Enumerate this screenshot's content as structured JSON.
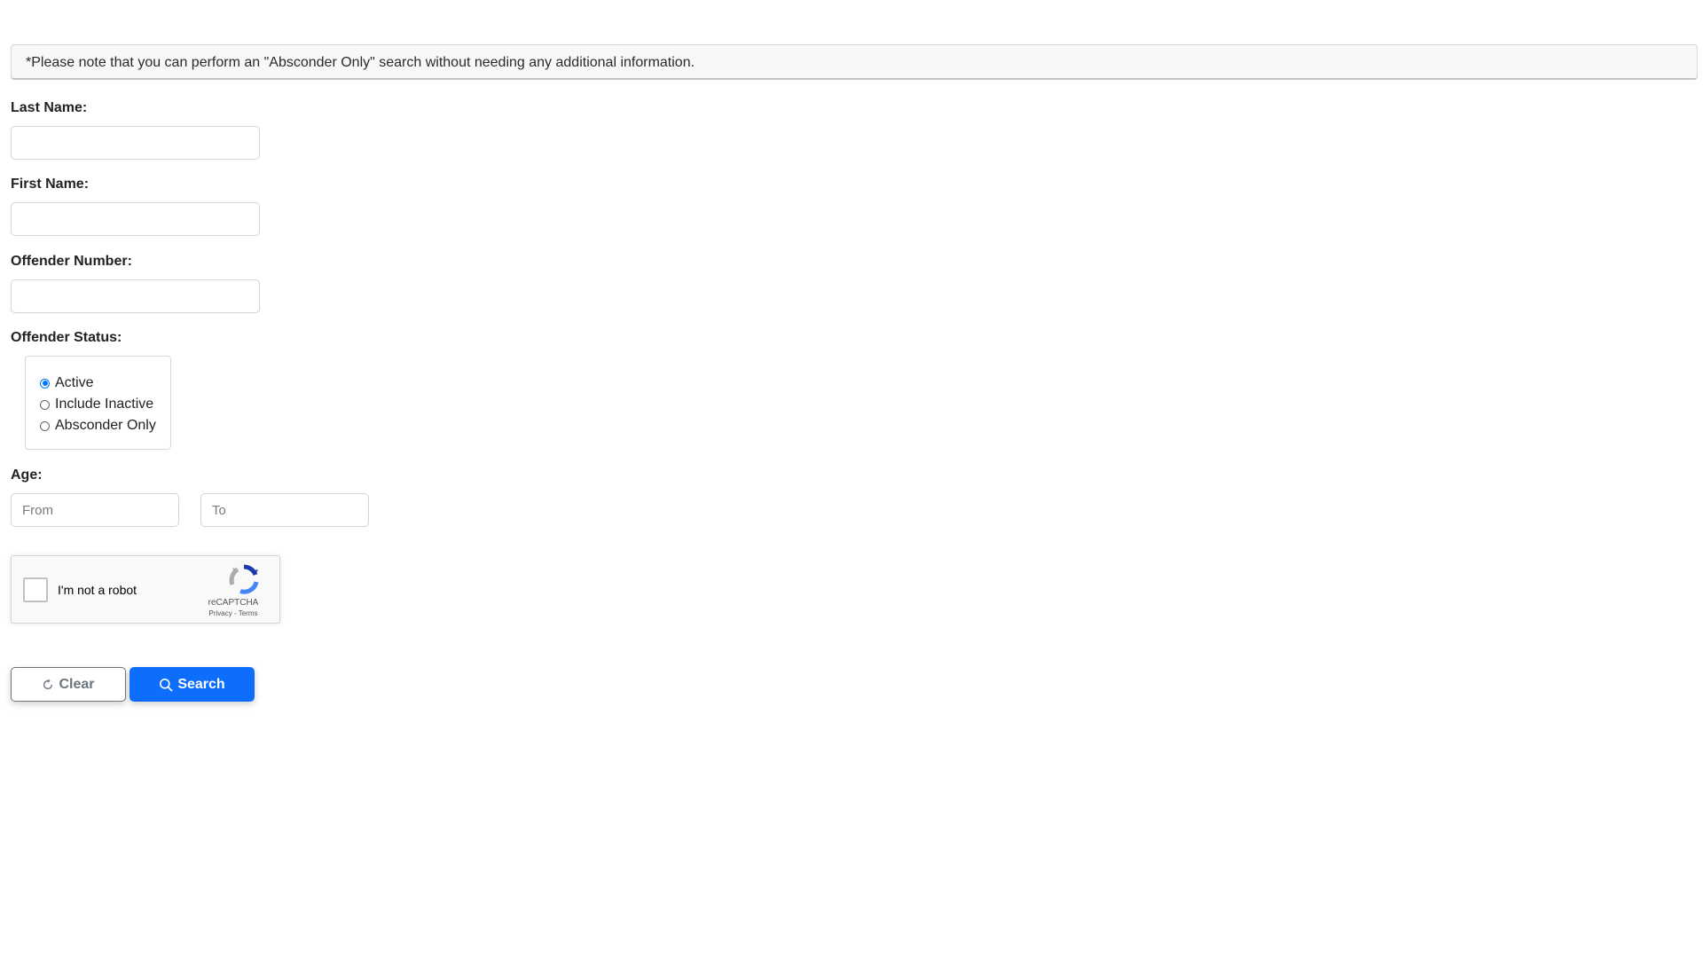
{
  "notice": {
    "text": "*Please note that you can perform an \"Absconder Only\" search without needing any additional information."
  },
  "form": {
    "last_name": {
      "label": "Last Name:",
      "value": ""
    },
    "first_name": {
      "label": "First Name:",
      "value": ""
    },
    "offender_number": {
      "label": "Offender Number:",
      "value": ""
    },
    "offender_status": {
      "label": "Offender Status:",
      "options": [
        "Active",
        "Include Inactive",
        "Absconder Only"
      ],
      "selected": "Active"
    },
    "age": {
      "label": "Age:",
      "from_placeholder": "From",
      "to_placeholder": "To",
      "from_value": "",
      "to_value": ""
    }
  },
  "captcha": {
    "label": "I'm not a robot",
    "brand": "reCAPTCHA",
    "privacy": "Privacy",
    "separator": " - ",
    "terms": "Terms",
    "checked": false
  },
  "buttons": {
    "clear_label": "Clear",
    "clear_icon": "refresh-icon",
    "search_label": "Search",
    "search_icon": "search-icon"
  },
  "colors": {
    "primary": "#0d6efd",
    "secondary": "#6c757d",
    "radio_accent": "#0075ff"
  }
}
